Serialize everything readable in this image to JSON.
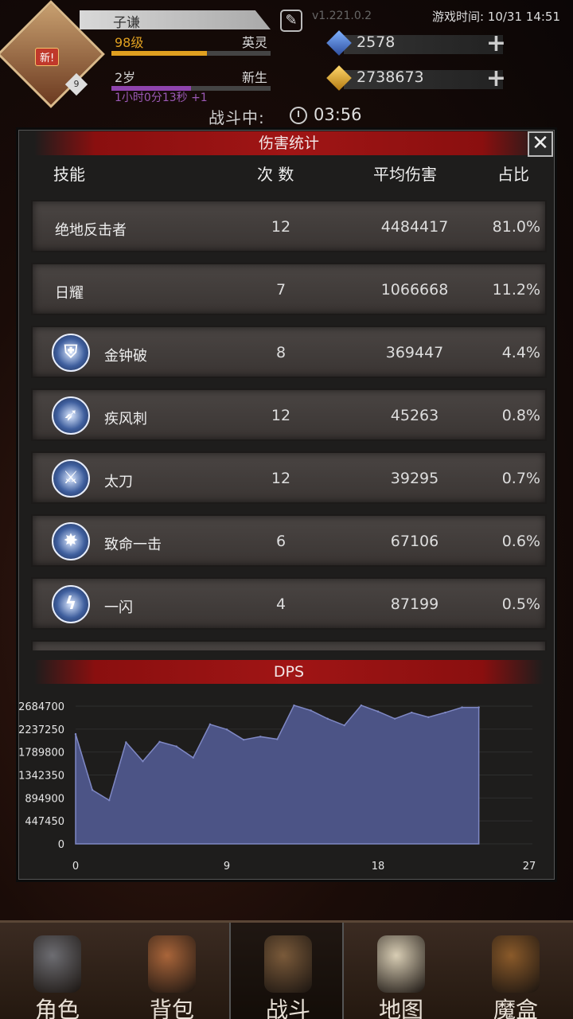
{
  "header": {
    "new_badge": "新!",
    "avatar_level": "9",
    "player_name": "子谦",
    "version": "v1.221.0.2",
    "game_time": "游戏时间: 10/31 14:51",
    "level_label": "98级",
    "rank_label": "英灵",
    "level_progress": 0.6,
    "age_label": "2岁",
    "age_rank": "新生",
    "age_progress": 0.5,
    "age_timer": "1小时0分13秒 +1",
    "gems": "2578",
    "gold": "2738673",
    "colors": {
      "level_bar": "#e0a020",
      "age_bar": "#8e44ad"
    }
  },
  "battle": {
    "status": "战斗中:",
    "timer": "03:56"
  },
  "modal": {
    "title": "伤害统计",
    "close_label": "✕",
    "columns": [
      "技能",
      "次 数",
      "平均伤害",
      "占比"
    ],
    "rows": [
      {
        "name": "绝地反击者",
        "icon": "",
        "count": "12",
        "avg": "4484417",
        "pct": "81.0%"
      },
      {
        "name": "日耀",
        "icon": "",
        "count": "7",
        "avg": "1066668",
        "pct": "11.2%"
      },
      {
        "name": "金钟破",
        "icon": "shield-skill-icon",
        "count": "8",
        "avg": "369447",
        "pct": "4.4%"
      },
      {
        "name": "疾风刺",
        "icon": "arrows-skill-icon",
        "count": "12",
        "avg": "45263",
        "pct": "0.8%"
      },
      {
        "name": "太刀",
        "icon": "sword-skill-icon",
        "count": "12",
        "avg": "39295",
        "pct": "0.7%"
      },
      {
        "name": "致命一击",
        "icon": "burst-skill-icon",
        "count": "6",
        "avg": "67106",
        "pct": "0.6%"
      },
      {
        "name": "一闪",
        "icon": "slash-skill-icon",
        "count": "4",
        "avg": "87199",
        "pct": "0.5%"
      }
    ],
    "chart_title": "DPS"
  },
  "chart_data": {
    "type": "area",
    "title": "DPS",
    "xlabel": "",
    "ylabel": "",
    "xlim": [
      0,
      27
    ],
    "ylim": [
      0,
      2684700
    ],
    "x_ticks": [
      "0",
      "9",
      "18",
      "27"
    ],
    "y_ticks": [
      "0",
      "447450",
      "894900",
      "1342350",
      "1789800",
      "2237250",
      "2684700"
    ],
    "grid": true,
    "color": "#4c5486",
    "x": [
      0,
      1,
      2,
      3,
      4,
      5,
      6,
      7,
      8,
      9,
      10,
      11,
      12,
      13,
      14,
      15,
      16,
      17,
      18,
      19,
      20,
      21,
      22,
      23,
      24
    ],
    "values": [
      2140000,
      1050000,
      850000,
      1980000,
      1610000,
      1990000,
      1900000,
      1680000,
      2330000,
      2230000,
      2030000,
      2090000,
      2040000,
      2700000,
      2600000,
      2440000,
      2310000,
      2700000,
      2580000,
      2440000,
      2560000,
      2470000,
      2560000,
      2660000,
      2660000
    ]
  },
  "nav": {
    "items": [
      {
        "label": "角色",
        "icon": "helmet-icon"
      },
      {
        "label": "背包",
        "icon": "backpack-icon"
      },
      {
        "label": "战斗",
        "icon": "sword-shield-icon"
      },
      {
        "label": "地图",
        "icon": "scroll-map-icon"
      },
      {
        "label": "魔盒",
        "icon": "magic-box-icon"
      }
    ],
    "active_index": 2
  }
}
